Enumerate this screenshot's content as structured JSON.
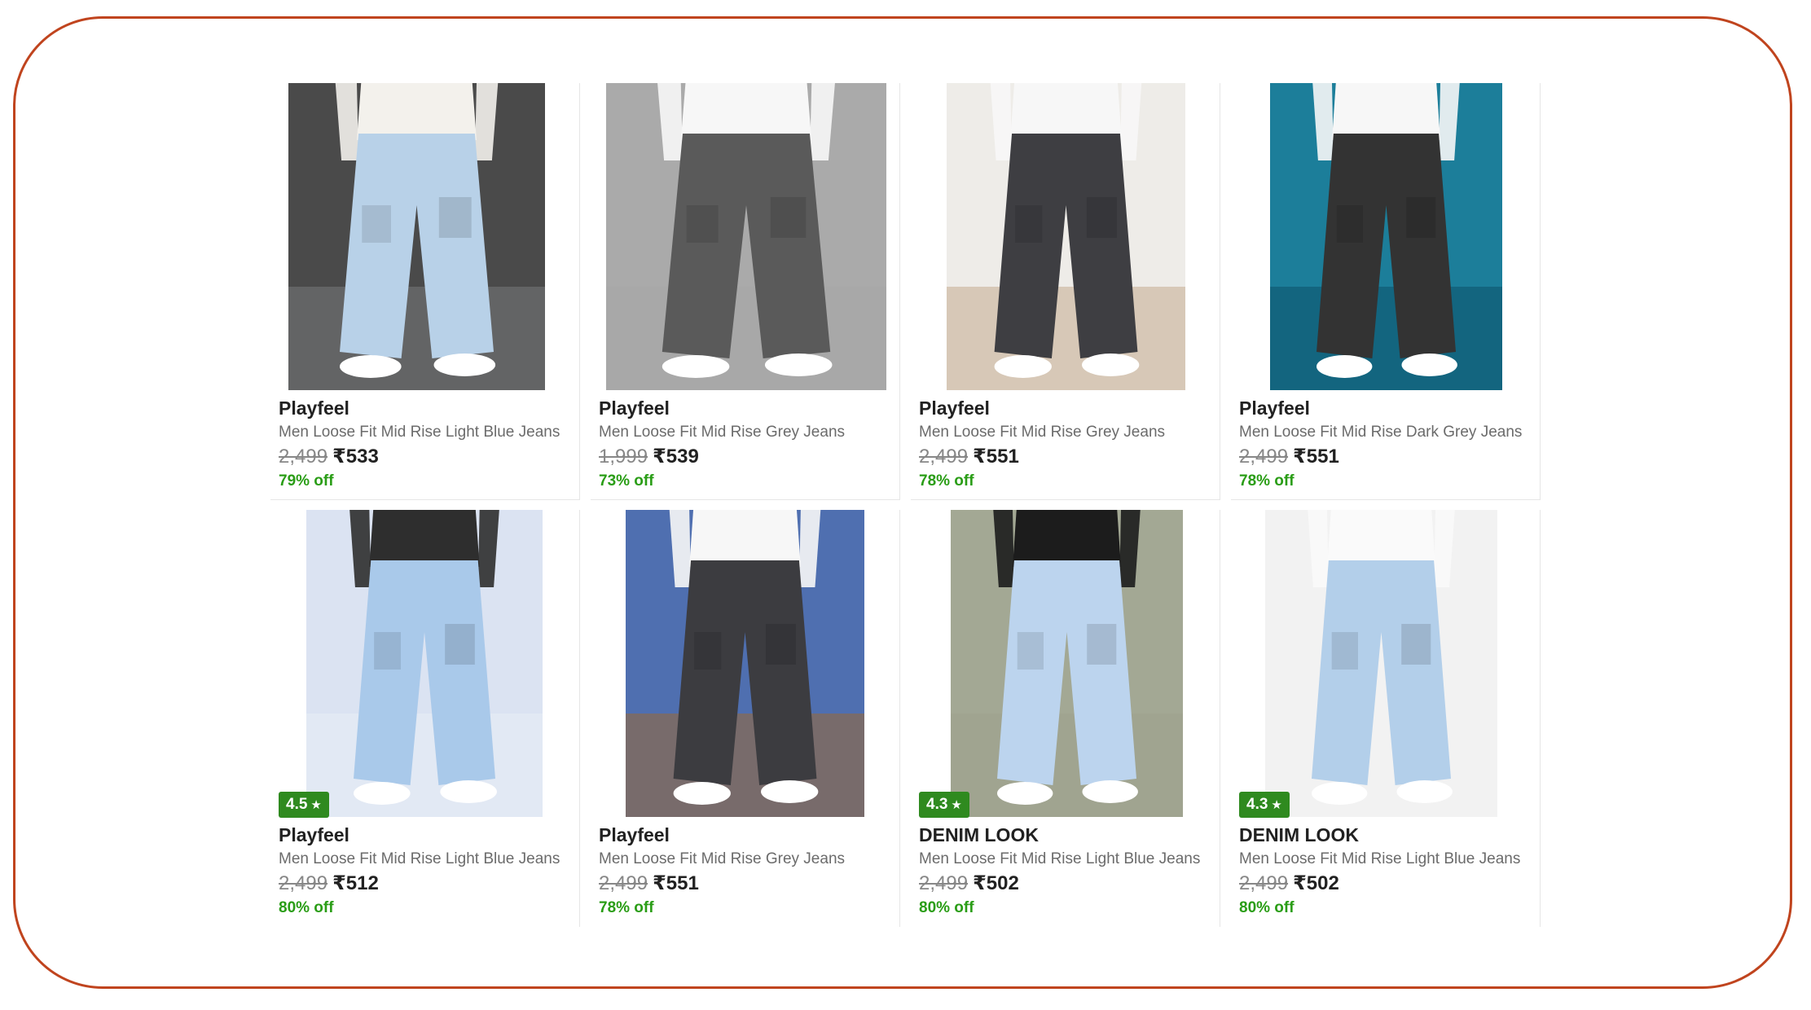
{
  "products": [
    {
      "brand": "Playfeel",
      "title": "Men Loose Fit Mid Rise Light Blue Jeans",
      "mrp": "2,499",
      "price": "₹533",
      "discount": "79% off",
      "rating": null,
      "image": "light-blue-cargo-jeans",
      "colors": {
        "bg": "#4a4a4a",
        "floor": "#6d6f70",
        "jeans": "#b8d1e8",
        "shirt": "#f3f1ec"
      }
    },
    {
      "brand": "Playfeel",
      "title": "Men Loose Fit Mid Rise Grey Jeans",
      "mrp": "1,999",
      "price": "₹539",
      "discount": "73% off",
      "rating": null,
      "image": "grey-cargo-jeans",
      "colors": {
        "bg": "#aaaaaa",
        "floor": "#a6a6a6",
        "jeans": "#5a5a5a",
        "shirt": "#f7f7f7"
      }
    },
    {
      "brand": "Playfeel",
      "title": "Men Loose Fit Mid Rise Grey Jeans",
      "mrp": "2,499",
      "price": "₹551",
      "discount": "78% off",
      "rating": null,
      "image": "grey-cargo-jeans",
      "colors": {
        "bg": "#eeece8",
        "floor": "#cdb9a3",
        "jeans": "#3e3e42",
        "shirt": "#f7f7f7"
      }
    },
    {
      "brand": "Playfeel",
      "title": "Men Loose Fit Mid Rise Dark Grey Jeans",
      "mrp": "2,499",
      "price": "₹551",
      "discount": "78% off",
      "rating": null,
      "image": "dark-grey-cargo-jeans",
      "colors": {
        "bg": "#1c7e9a",
        "floor": "#0f5b73",
        "jeans": "#333333",
        "shirt": "#f7f7f7"
      }
    },
    {
      "brand": "Playfeel",
      "title": "Men Loose Fit Mid Rise Light Blue Jeans",
      "mrp": "2,499",
      "price": "₹512",
      "discount": "80% off",
      "rating": "4.5",
      "image": "light-blue-cargo-jeans",
      "colors": {
        "bg": "#dbe3f2",
        "floor": "#e6ebf5",
        "jeans": "#a9c9ea",
        "shirt": "#2e2e2e"
      }
    },
    {
      "brand": "Playfeel",
      "title": "Men Loose Fit Mid Rise Grey Jeans",
      "mrp": "2,499",
      "price": "₹551",
      "discount": "78% off",
      "rating": null,
      "image": "grey-cargo-jeans",
      "colors": {
        "bg": "#4f6fb0",
        "floor": "#8a6a4f",
        "jeans": "#3c3c40",
        "shirt": "#f7f7f7"
      }
    },
    {
      "brand": "DENIM LOOK",
      "title": "Men Loose Fit Mid Rise Light Blue Jeans",
      "mrp": "2,499",
      "price": "₹502",
      "discount": "80% off",
      "rating": "4.3",
      "image": "light-blue-baggy-jeans",
      "colors": {
        "bg": "#a3a894",
        "floor": "#9ea28f",
        "jeans": "#bcd4ee",
        "shirt": "#1c1c1c"
      }
    },
    {
      "brand": "DENIM LOOK",
      "title": "Men Loose Fit Mid Rise Light Blue Jeans",
      "mrp": "2,499",
      "price": "₹502",
      "discount": "80% off",
      "rating": "4.3",
      "image": "light-blue-baggy-jeans",
      "colors": {
        "bg": "#f2f2f2",
        "floor": "#f2f2f2",
        "jeans": "#b3cfea",
        "shirt": "#fafafa"
      }
    }
  ],
  "rating_star": "★"
}
